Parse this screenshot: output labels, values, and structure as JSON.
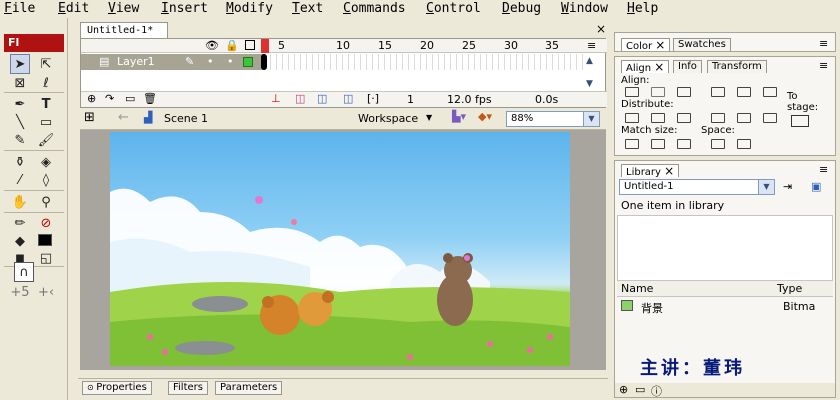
{
  "menu": [
    "File",
    "Edit",
    "View",
    "Insert",
    "Modify",
    "Text",
    "Commands",
    "Control",
    "Debug",
    "Window",
    "Help"
  ],
  "tools_panel": {
    "logo": "Fl"
  },
  "document": {
    "tab_label": "Untitled-1*"
  },
  "timeline": {
    "frame_numbers": [
      "1",
      "5",
      "10",
      "15",
      "20",
      "25",
      "30",
      "35"
    ],
    "layer_name": "Layer1",
    "current_frame": "1",
    "frame_rate": "12.0 fps",
    "elapsed_time": "0.0s"
  },
  "edit_bar": {
    "scene_label": "Scene 1",
    "workspace_label": "Workspace",
    "zoom": "88%"
  },
  "properties_tabs": [
    "Properties",
    "Filters",
    "Parameters"
  ],
  "color_panel": {
    "tabs": [
      "Color",
      "Swatches"
    ]
  },
  "align_panel": {
    "tabs": [
      "Align",
      "Info",
      "Transform"
    ],
    "align_label": "Align:",
    "distribute_label": "Distribute:",
    "match_size_label": "Match size:",
    "space_label": "Space:",
    "to_stage_label": "To stage:"
  },
  "library_panel": {
    "tab": "Library",
    "document_select": "Untitled-1",
    "item_count_text": "One item in library",
    "col_name": "Name",
    "col_type": "Type",
    "items": [
      {
        "name": "背景",
        "type": "Bitma"
      }
    ]
  },
  "watermark": "主讲：董玮",
  "colors": {
    "flash_red": "#b01212",
    "layer_row": "#a8a494",
    "stage_sky": "#5db4ec",
    "stage_grass": "#86c93a"
  }
}
